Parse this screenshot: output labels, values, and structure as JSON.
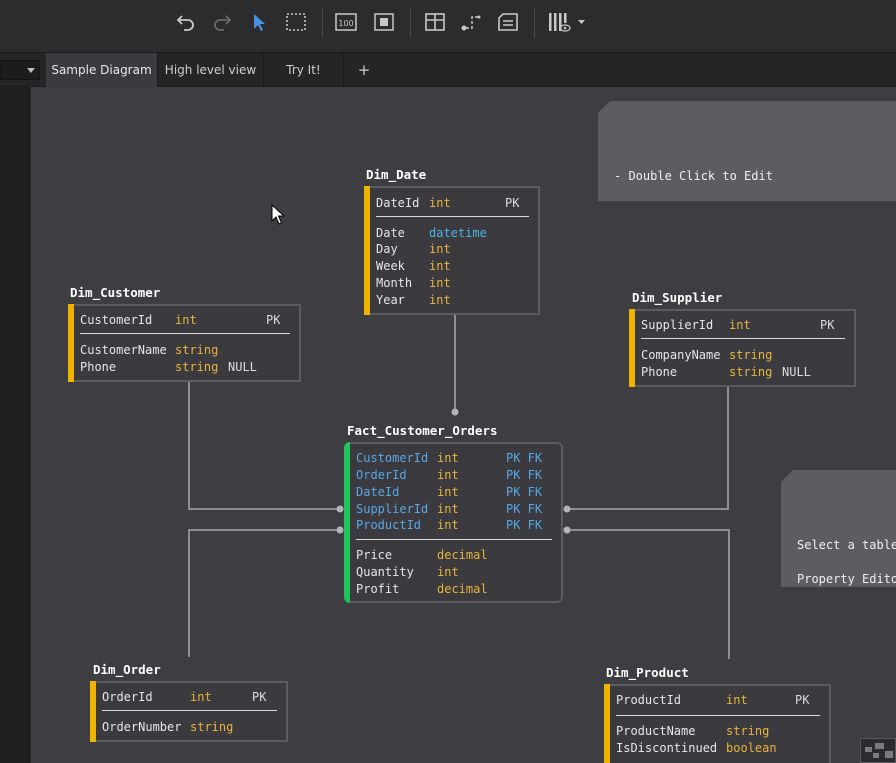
{
  "toolbar": {
    "buttons": [
      "undo-icon",
      "redo-icon",
      "pointer-icon",
      "marquee-select-icon",
      "zoom-100-icon",
      "fit-screen-icon",
      "add-table-icon",
      "add-relation-icon",
      "add-note-icon",
      "view-options-icon"
    ],
    "zoom_label": "100"
  },
  "tabs": [
    {
      "label": "Sample Diagram",
      "active": true
    },
    {
      "label": "High level view"
    },
    {
      "label": "Try It!"
    },
    {
      "label": "+"
    }
  ],
  "notes": {
    "edit_note": "- Double Click to Edit\n\n- Single Click to select, and then use\nProperties Panel for Indexes, Column Det",
    "select_note": "Select a table\n\nProperty Edito\n\nTo change it"
  },
  "entities": {
    "dim_date": {
      "name": "Dim_Date",
      "keys": [
        {
          "col": "DateId",
          "type": "int",
          "key": "PK"
        }
      ],
      "cols": [
        {
          "col": "Date",
          "type": "datetime"
        },
        {
          "col": "Day",
          "type": "int"
        },
        {
          "col": "Week",
          "type": "int"
        },
        {
          "col": "Month",
          "type": "int"
        },
        {
          "col": "Year",
          "type": "int"
        }
      ]
    },
    "dim_customer": {
      "name": "Dim_Customer",
      "keys": [
        {
          "col": "CustomerId",
          "type": "int",
          "key": "PK"
        }
      ],
      "cols": [
        {
          "col": "CustomerName",
          "type": "string"
        },
        {
          "col": "Phone",
          "type": "string",
          "null": "NULL"
        }
      ]
    },
    "dim_supplier": {
      "name": "Dim_Supplier",
      "keys": [
        {
          "col": "SupplierId",
          "type": "int",
          "key": "PK"
        }
      ],
      "cols": [
        {
          "col": "CompanyName",
          "type": "string"
        },
        {
          "col": "Phone",
          "type": "string",
          "null": "NULL"
        }
      ]
    },
    "fact_customer_orders": {
      "name": "Fact_Customer_Orders",
      "keys": [
        {
          "col": "CustomerId",
          "type": "int",
          "key": "PK FK"
        },
        {
          "col": "OrderId",
          "type": "int",
          "key": "PK FK"
        },
        {
          "col": "DateId",
          "type": "int",
          "key": "PK FK"
        },
        {
          "col": "SupplierId",
          "type": "int",
          "key": "PK FK"
        },
        {
          "col": "ProductId",
          "type": "int",
          "key": "PK FK"
        }
      ],
      "cols": [
        {
          "col": "Price",
          "type": "decimal"
        },
        {
          "col": "Quantity",
          "type": "int"
        },
        {
          "col": "Profit",
          "type": "decimal"
        }
      ]
    },
    "dim_order": {
      "name": "Dim_Order",
      "keys": [
        {
          "col": "OrderId",
          "type": "int",
          "key": "PK"
        }
      ],
      "cols": [
        {
          "col": "OrderNumber",
          "type": "string"
        }
      ]
    },
    "dim_product": {
      "name": "Dim_Product",
      "keys": [
        {
          "col": "ProductId",
          "type": "int",
          "key": "PK"
        }
      ],
      "cols": [
        {
          "col": "ProductName",
          "type": "string"
        },
        {
          "col": "IsDiscontinued",
          "type": "boolean"
        }
      ]
    }
  },
  "colors": {
    "dimension_stripe": "#f0b400",
    "fact_stripe": "#22c35a",
    "type_text": "#e9b43a",
    "fk_text": "#58a7e6"
  }
}
